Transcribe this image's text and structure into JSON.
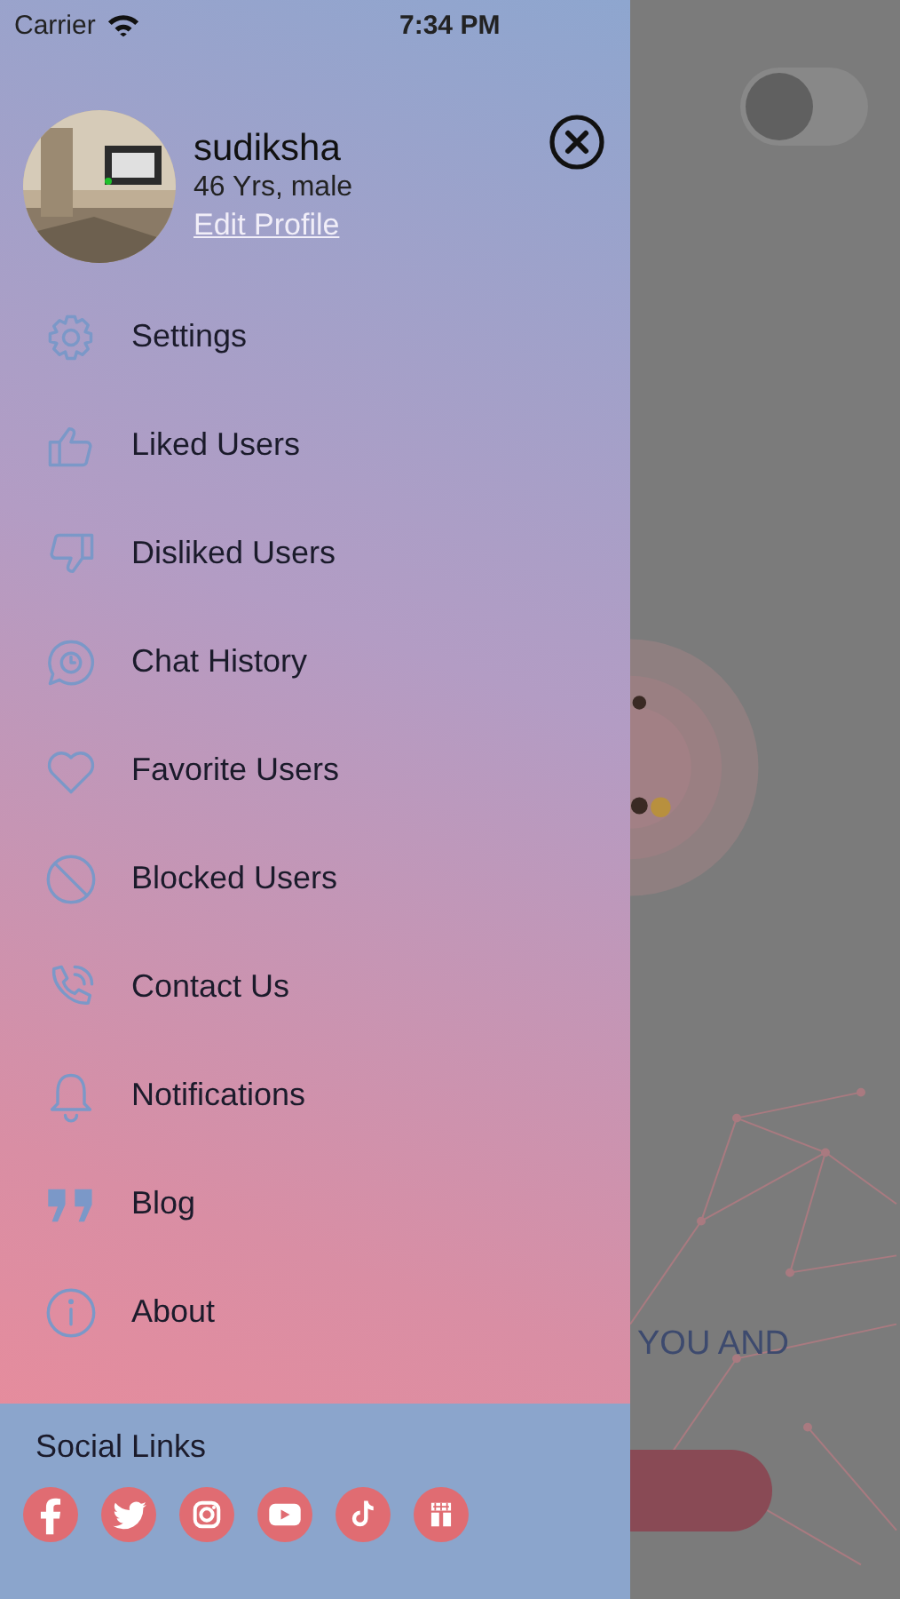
{
  "status_bar": {
    "carrier": "Carrier",
    "time": "7:34 PM"
  },
  "profile": {
    "name": "sudiksha",
    "details": "46 Yrs, male",
    "edit_link": "Edit Profile"
  },
  "menu": [
    {
      "kind": "gear",
      "label": "Settings"
    },
    {
      "kind": "thumbs-up",
      "label": "Liked Users"
    },
    {
      "kind": "thumbs-down",
      "label": "Disliked Users"
    },
    {
      "kind": "chat",
      "label": "Chat History"
    },
    {
      "kind": "heart",
      "label": "Favorite Users"
    },
    {
      "kind": "block",
      "label": "Blocked Users"
    },
    {
      "kind": "phone",
      "label": "Contact Us"
    },
    {
      "kind": "bell",
      "label": "Notifications"
    },
    {
      "kind": "quote",
      "label": "Blog"
    },
    {
      "kind": "info",
      "label": "About"
    }
  ],
  "social": {
    "title": "Social Links",
    "links": [
      {
        "kind": "facebook"
      },
      {
        "kind": "twitter"
      },
      {
        "kind": "instagram"
      },
      {
        "kind": "youtube"
      },
      {
        "kind": "tiktok"
      },
      {
        "kind": "store"
      }
    ]
  },
  "background": {
    "toggle": {
      "on": false
    },
    "caption": "YOU AND"
  }
}
